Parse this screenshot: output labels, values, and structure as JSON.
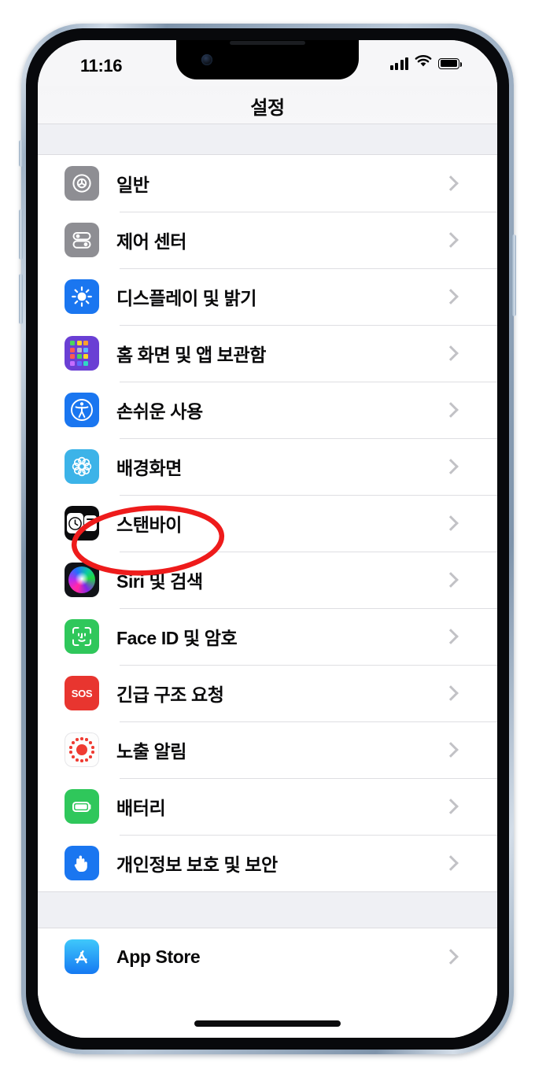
{
  "device": {
    "name": "iPhone",
    "frame_color": "#9fb2c6",
    "bezel_color": "#08090c"
  },
  "status_bar": {
    "time": "11:16",
    "cellular_icon": "cellular-signal-icon",
    "cellular_bars": 4,
    "wifi_icon": "wifi-icon",
    "battery_icon": "battery-full-icon",
    "battery_level": 100
  },
  "nav": {
    "title": "설정"
  },
  "annotation": {
    "type": "ellipse",
    "color": "#ee1b1b",
    "target": "스탠바이"
  },
  "sections": [
    {
      "id": "system",
      "items": [
        {
          "label": "일반",
          "icon": "gear-icon",
          "icon_color": "#8e8e93",
          "accessory": "chevron-right-icon"
        },
        {
          "label": "제어 센터",
          "icon": "sliders-icon",
          "icon_color": "#8e8e93",
          "accessory": "chevron-right-icon"
        },
        {
          "label": "디스플레이 및 밝기",
          "icon": "brightness-icon",
          "icon_color": "#1a76f0",
          "accessory": "chevron-right-icon"
        },
        {
          "label": "홈 화면 및 앱 보관함",
          "icon": "app-grid-icon",
          "icon_color": "#6a3fd4",
          "accessory": "chevron-right-icon"
        },
        {
          "label": "손쉬운 사용",
          "icon": "accessibility-icon",
          "icon_color": "#1a76f0",
          "accessory": "chevron-right-icon"
        },
        {
          "label": "배경화면",
          "icon": "wallpaper-icon",
          "icon_color": "#3cb3e8",
          "accessory": "chevron-right-icon"
        },
        {
          "label": "스탠바이",
          "icon": "standby-clock-icon",
          "icon_color": "#0b0b0d",
          "accessory": "chevron-right-icon"
        },
        {
          "label": "Siri 및 검색",
          "icon": "siri-orb-icon",
          "icon_color": "#111318",
          "accessory": "chevron-right-icon"
        },
        {
          "label": "Face ID 및 암호",
          "icon": "face-id-icon",
          "icon_color": "#2fc75b",
          "accessory": "chevron-right-icon"
        },
        {
          "label": "긴급 구조 요청",
          "icon": "sos-icon",
          "icon_color": "#e8352f",
          "accessory": "chevron-right-icon",
          "icon_text": "SOS"
        },
        {
          "label": "노출 알림",
          "icon": "exposure-notification-icon",
          "icon_color": "#ef3b32",
          "accessory": "chevron-right-icon"
        },
        {
          "label": "배터리",
          "icon": "battery-icon",
          "icon_color": "#2fc75b",
          "accessory": "chevron-right-icon"
        },
        {
          "label": "개인정보 보호 및 보안",
          "icon": "hand-privacy-icon",
          "icon_color": "#1a76f0",
          "accessory": "chevron-right-icon"
        }
      ]
    },
    {
      "id": "stores",
      "items": [
        {
          "label": "App Store",
          "icon": "app-store-icon",
          "icon_color": "#1579f2",
          "accessory": "chevron-right-icon"
        }
      ]
    }
  ],
  "home_indicator": {
    "label": "home-indicator"
  }
}
